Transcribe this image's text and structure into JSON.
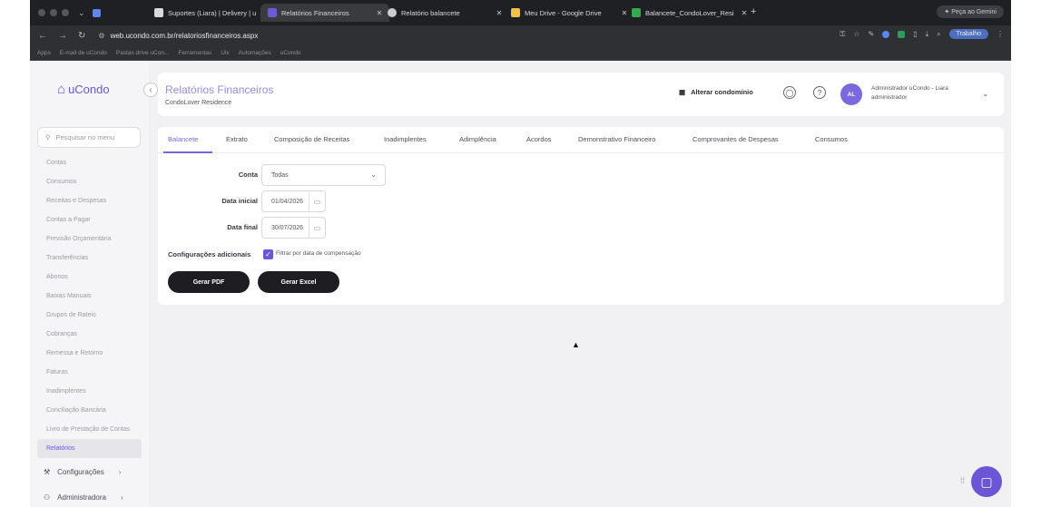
{
  "browser": {
    "tabs": [
      {
        "label": "Suportes (Liara) | Delivery | u",
        "color": "#d7d9de",
        "active": false
      },
      {
        "label": "Relatórios Financeiros",
        "color": "#6c5bd4",
        "active": true
      },
      {
        "label": "Relatório balancete",
        "color": "#c9ccd2",
        "active": false
      },
      {
        "label": "Meu Drive - Google Drive",
        "color": "#f2c14a",
        "active": false
      },
      {
        "label": "Balancete_CondoLover_Resi",
        "color": "#34a853",
        "active": false
      }
    ],
    "gemini_label": "Peça ao Gemini",
    "url": "web.ucondo.com.br/relatoriosfinanceiros.aspx",
    "profile_label": "Trabalho",
    "bookmarks": [
      "Apps",
      "E-mail de uCondo",
      "Pastas drive uCon...",
      "Ferramentas",
      "Ulx",
      "Automações",
      "uCondo"
    ]
  },
  "sidebar": {
    "logo_text": "uCondo",
    "search_placeholder": "Pesquisar no menu",
    "items": [
      {
        "label": "Contas",
        "active": false
      },
      {
        "label": "Consumos",
        "active": false
      },
      {
        "label": "Receitas e Despesas",
        "active": false
      },
      {
        "label": "Contas a Pagar",
        "active": false
      },
      {
        "label": "Previsão Orçamentária",
        "active": false
      },
      {
        "label": "Transferências",
        "active": false
      },
      {
        "label": "Abonos",
        "active": false
      },
      {
        "label": "Baixas Manuais",
        "active": false
      },
      {
        "label": "Grupos de Rateio",
        "active": false
      },
      {
        "label": "Cobranças",
        "active": false
      },
      {
        "label": "Remessa e Retorno",
        "active": false
      },
      {
        "label": "Faturas",
        "active": false
      },
      {
        "label": "Inadimplentes",
        "active": false
      },
      {
        "label": "Conciliação Bancária",
        "active": false
      },
      {
        "label": "Livro de Prestação de Contas",
        "active": false
      },
      {
        "label": "Relatórios",
        "active": true
      }
    ],
    "groups": {
      "configuracoes": "Configurações",
      "administradora": "Administradora"
    }
  },
  "header": {
    "title": "Relatórios Financeiros",
    "subtitle": "CondoLover Residence",
    "change_condo": "Alterar condomínio",
    "avatar_initials": "AL",
    "user_name": "Administrador uCondo - Liara",
    "user_role": "administrador"
  },
  "tabs": [
    "Balancete",
    "Extrato",
    "Composição de Receitas",
    "Inadimplentes",
    "Adimplência",
    "Acordos",
    "Demonstrativo Financeiro",
    "Comprovantes de Despesas",
    "Consumos"
  ],
  "form": {
    "conta_label": "Conta",
    "conta_value": "Todas",
    "data_inicial_label": "Data inicial",
    "data_inicial_value": "01/04/2026",
    "data_final_label": "Data final",
    "data_final_value": "30/07/2026",
    "config_label": "Configurações adicionais",
    "filter_label": "Filtrar por data de compensação",
    "filter_checked": true,
    "pdf_button": "Gerar PDF",
    "excel_button": "Gerar Excel"
  },
  "colors": {
    "brand": "#6c56d6",
    "dark_button": "#1e1e22"
  }
}
